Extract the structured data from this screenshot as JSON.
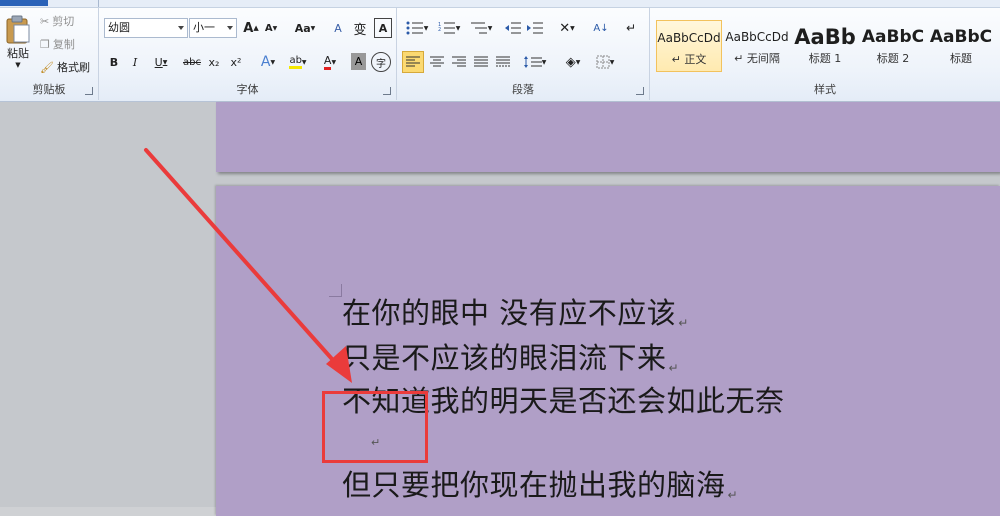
{
  "ribbon": {
    "clipboard": {
      "group_label": "剪贴板",
      "paste_label": "粘贴",
      "cut_label": "剪切",
      "copy_label": "复制",
      "format_painter_label": "格式刷"
    },
    "font": {
      "group_label": "字体",
      "font_name": "幼圆",
      "font_size": "小一",
      "grow_font": "A",
      "shrink_font": "A",
      "change_case": "Aa",
      "clear_format": "A",
      "phonetic_guide": "变",
      "char_border": "A",
      "bold": "B",
      "italic": "I",
      "underline": "U",
      "strikethrough": "abc",
      "subscript": "x₂",
      "superscript": "x²",
      "text_effects": "A",
      "highlight": "ab",
      "font_color": "A",
      "char_shading": "A",
      "enclose_char": "字"
    },
    "paragraph": {
      "group_label": "段落"
    },
    "styles": {
      "group_label": "样式",
      "items": [
        {
          "sample": "AaBbCcDd",
          "name": "↵ 正文"
        },
        {
          "sample": "AaBbCcDd",
          "name": "↵ 无间隔"
        },
        {
          "sample": "AaBb",
          "name": "标题 1"
        },
        {
          "sample": "AaBbC",
          "name": "标题 2"
        },
        {
          "sample": "AaBbC",
          "name": "标题"
        }
      ]
    }
  },
  "document": {
    "lines": [
      "在你的眼中 没有应不应该",
      "只是不应该的眼泪流下来",
      "不知道我的明天是否还会如此无奈",
      "",
      "但只要把你现在抛出我的脑海"
    ],
    "paragraph_mark": "↵"
  },
  "colors": {
    "page_background": "#b09fc7",
    "annotation_red": "#ea3b3b",
    "ribbon_top": "#fdfeff",
    "selected_style": "#ffeab0"
  }
}
